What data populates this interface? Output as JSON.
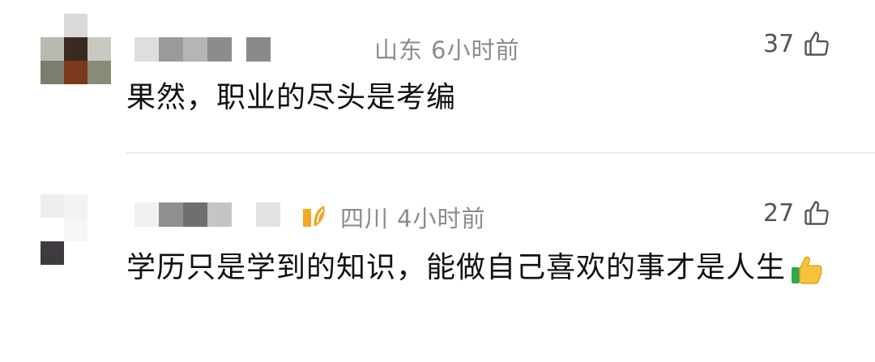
{
  "comments": [
    {
      "location": "山东",
      "time": "6小时前",
      "likes": "37",
      "text": "果然，职业的尽头是考编",
      "username_masked": true,
      "avatar_pixelated": true
    },
    {
      "location": "四川",
      "time": "4小时前",
      "likes": "27",
      "text": "学历只是学到的知识，能做自己喜欢的事才是人生",
      "username_masked": true,
      "avatar_pixelated": true,
      "badge_icon": "orange-badge-icon",
      "trailing_emoji": "thumbs-up-emoji"
    }
  ],
  "icons": {
    "like": "thumbs-up-outline-icon"
  },
  "colors": {
    "meta_text": "#8c8c8c",
    "content_text": "#111111",
    "divider": "#ececec",
    "badge": "#f5a623"
  }
}
